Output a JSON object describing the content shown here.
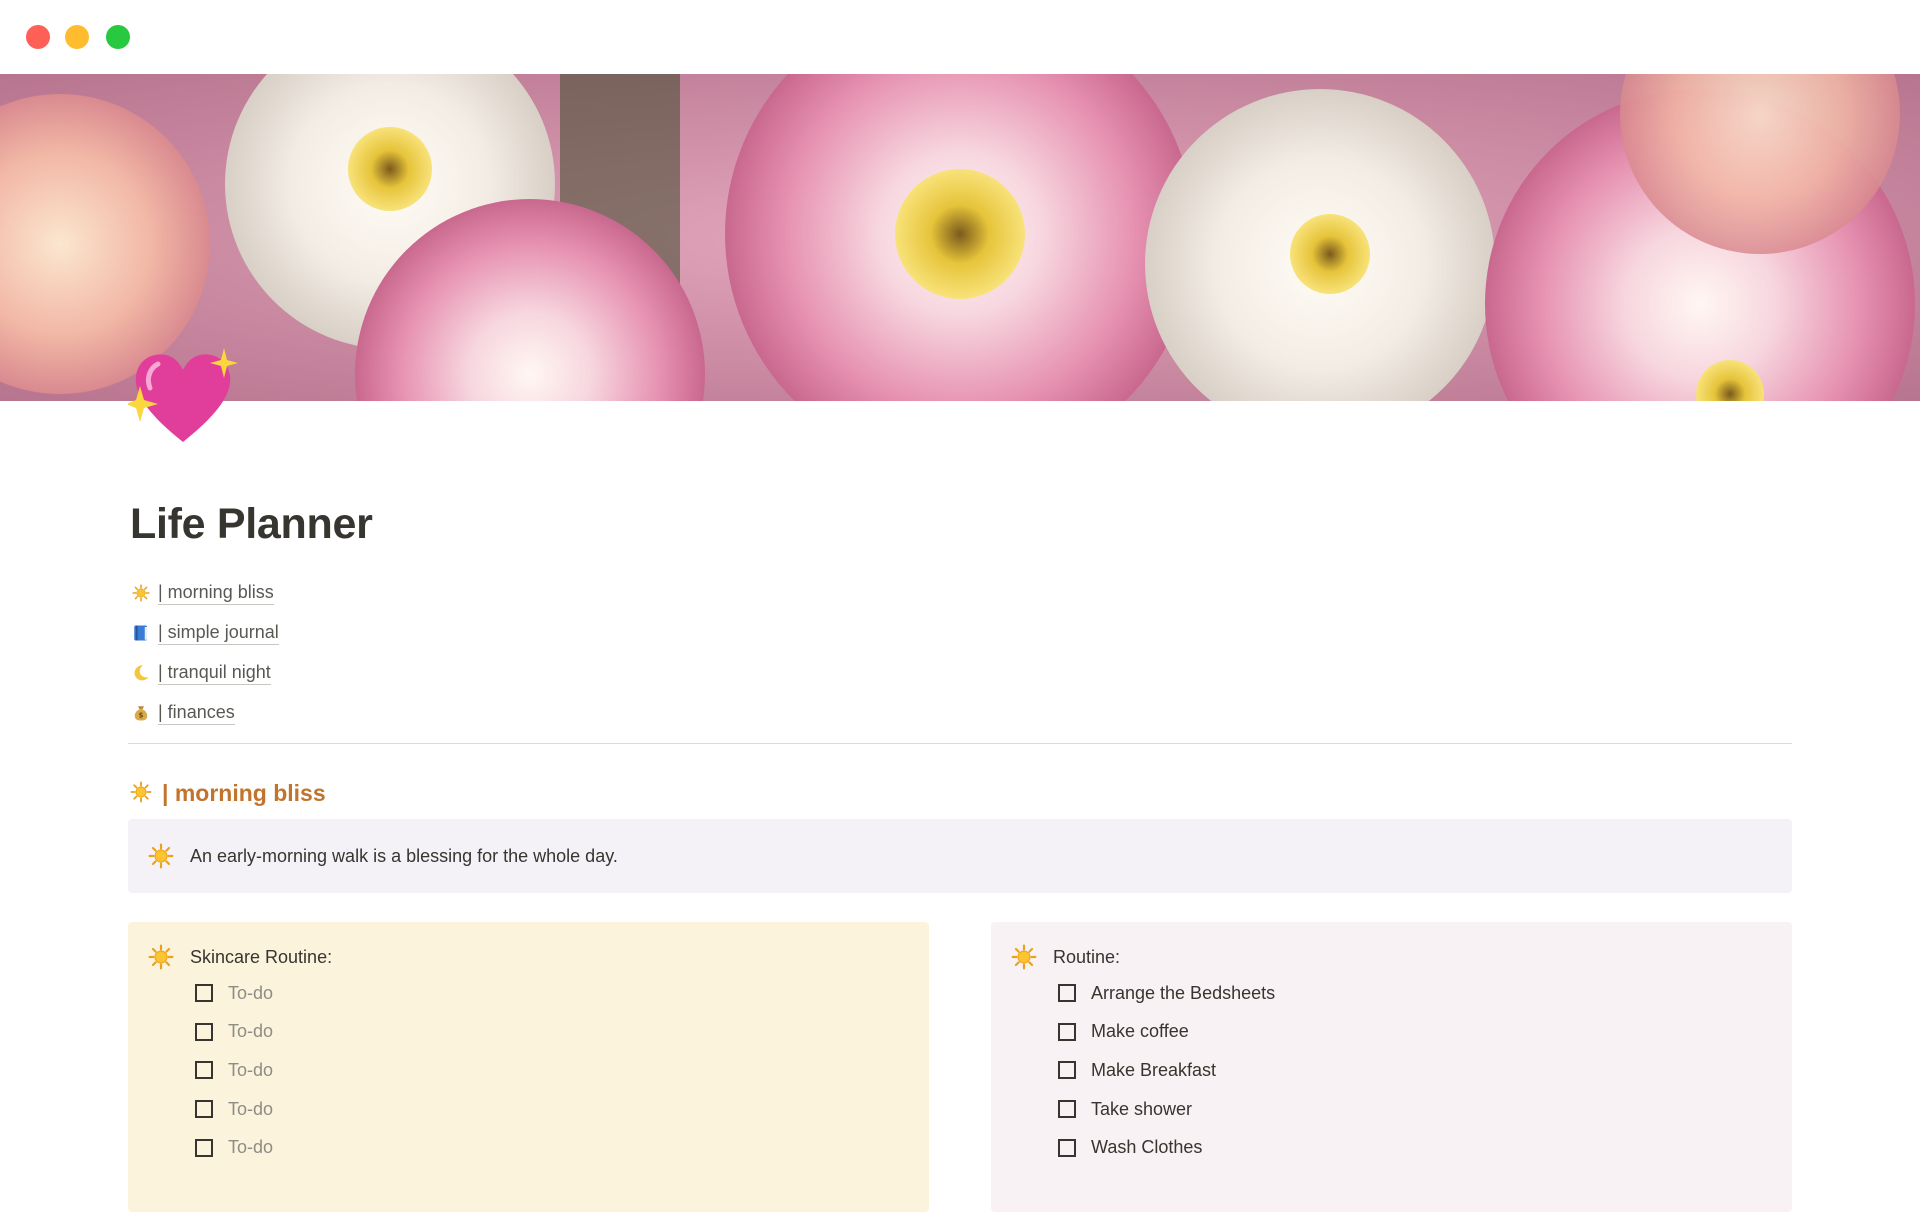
{
  "window": {
    "controls": [
      "close",
      "minimize",
      "maximize"
    ]
  },
  "page": {
    "icon": "sparkling-heart-icon",
    "title": "Life Planner"
  },
  "links": [
    {
      "icon": "sun-icon",
      "label": "| morning bliss"
    },
    {
      "icon": "blue-book-icon",
      "label": "| simple journal"
    },
    {
      "icon": "crescent-moon-icon",
      "label": "| tranquil night"
    },
    {
      "icon": "money-bag-icon",
      "label": "| finances"
    }
  ],
  "section": {
    "icon": "sun-icon",
    "heading": "| morning bliss",
    "quote": {
      "icon": "sun-icon",
      "text": "An early-morning walk is a blessing for the whole day."
    }
  },
  "skincare": {
    "icon": "sun-icon",
    "title": "Skincare Routine:",
    "items": [
      "To-do",
      "To-do",
      "To-do",
      "To-do",
      "To-do"
    ]
  },
  "routine": {
    "icon": "sun-icon",
    "title": "Routine:",
    "items": [
      "Arrange the Bedsheets",
      "Make coffee",
      "Make Breakfast",
      "Take shower",
      "Wash Clothes"
    ]
  },
  "colors": {
    "heading_accent": "#c2742c",
    "quote_background": "#f5f2f7",
    "skincare_background": "#fbf3dc",
    "routine_background": "#f8f2f4"
  }
}
